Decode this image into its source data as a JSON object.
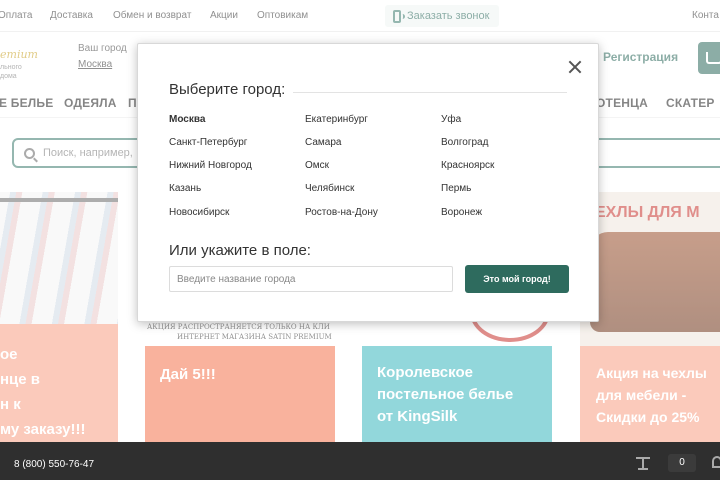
{
  "topbar": {
    "links": [
      "Оплата",
      "Доставка",
      "Обмен и возврат",
      "Акции",
      "Оптовикам"
    ],
    "callback_label": "Заказать звонок",
    "contacts_label": "Конта"
  },
  "header": {
    "logo_script": "emium",
    "logo_line1": "льного",
    "logo_line2": "дома",
    "city_label": "Ваш город",
    "city_value": "Москва",
    "register_label": "Регистрация"
  },
  "nav": {
    "items": [
      "Е БЕЛЬЕ",
      "ОДЕЯЛА",
      "П",
      "ОТЕНЦА",
      "СКАТЕР"
    ]
  },
  "search": {
    "placeholder": "Поиск, например,"
  },
  "banners": {
    "b1_text": "ое\nнце в\nн к\nму заказу!!!",
    "b2_ticker_1": "АКЦИЯ РАСПРОСТРАНЯЕТСЯ ТОЛЬКО НА КЛИ",
    "b2_ticker_2": "ИНТЕРНЕТ МАГАЗИНА SATIN PREMIUM",
    "b2_text": "Дай 5!!!",
    "b3_text": "Королевское\nпостельное белье\nот KingSilk",
    "b4_head": "ЕХЛЫ ДЛЯ М",
    "b4_text": "Акция на чехлы\nдля мебели -\nСкидки до 25%"
  },
  "bottombar": {
    "phone": "8 (800) 550-76-47",
    "compare_count": "0"
  },
  "modal": {
    "title": "Выберите город:",
    "cities": [
      [
        "Москва",
        "Екатеринбург",
        "Уфа"
      ],
      [
        "Санкт-Петербург",
        "Самара",
        "Волгоград"
      ],
      [
        "Нижний Новгород",
        "Омск",
        "Красноярск"
      ],
      [
        "Казань",
        "Челябинск",
        "Пермь"
      ],
      [
        "Новосибирск",
        "Ростов-на-Дону",
        "Воронеж"
      ]
    ],
    "subtitle": "Или укажите в поле:",
    "input_placeholder": "Введите название города",
    "submit_label": "Это мой город!"
  }
}
